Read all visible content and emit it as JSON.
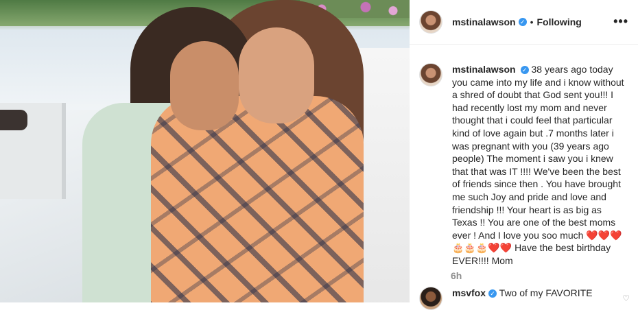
{
  "post": {
    "author": "mstinalawson",
    "follow_state": "Following",
    "more": "•••",
    "caption": "38 years ago today you came into my life and i know without a shred of doubt that God sent you!!! I had recently lost my mom and never thought that i could feel that particular kind of love again but .7 months later i was pregnant with you (39 years ago people) The moment i saw you i knew that that was IT !!!! We've been the best of friends since then . You have brought me such Joy and pride and love and friendship !!! Your heart is as big as Texas !! You are one of the best moms ever ! And I love you soo much",
    "caption_emojis": "❤️❤️❤️🎂🎂🎂❤️❤️",
    "caption_end": "Have the best birthday EVER!!!! Mom",
    "time_ago": "6h"
  },
  "comments": [
    {
      "author": "msvfox",
      "text": "Two of my FAVORITE"
    }
  ],
  "icons": {
    "verified": "verified-badge-icon",
    "more": "more-options-icon",
    "like": "heart-icon"
  },
  "colors": {
    "verified_blue": "#3897f0",
    "secondary_text": "#8e8e8e"
  }
}
